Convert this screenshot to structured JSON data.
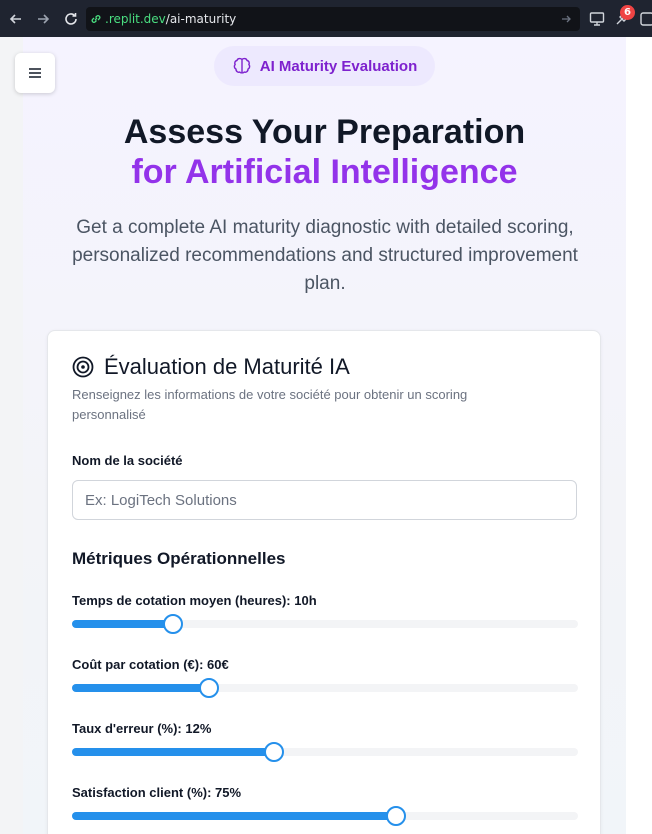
{
  "browser": {
    "url_domain": ".replit.dev",
    "url_path": "/ai-maturity",
    "badge_count": "6"
  },
  "hero": {
    "pill_label": "AI Maturity Evaluation",
    "title_line1": "Assess Your Preparation",
    "title_line2": "for Artificial Intelligence",
    "description": "Get a complete AI maturity diagnostic with detailed scoring, personalized recommendations and structured improvement plan."
  },
  "card": {
    "title": "Évaluation de Maturité IA",
    "description": "Renseignez les informations de votre société pour obtenir un scoring personnalisé",
    "company_label": "Nom de la société",
    "company_placeholder": "Ex: LogiTech Solutions",
    "company_value": "",
    "section_title": "Métriques Opérationnelles",
    "sliders": [
      {
        "label": "Temps de cotation moyen (heures): 10h",
        "fraction": 0.2
      },
      {
        "label": "Coût par cotation (€): 60€",
        "fraction": 0.27
      },
      {
        "label": "Taux d'erreur (%): 12%",
        "fraction": 0.4
      },
      {
        "label": "Satisfaction client (%): 75%",
        "fraction": 0.64
      }
    ]
  },
  "colors": {
    "accent_purple": "#9333ea",
    "slider_blue": "#2590eb"
  },
  "icons": [
    "arrow-left-icon",
    "arrow-right-icon",
    "reload-icon",
    "link-icon",
    "go-icon",
    "monitor-icon",
    "extension-icon",
    "menu-icon",
    "brain-icon",
    "target-icon"
  ]
}
